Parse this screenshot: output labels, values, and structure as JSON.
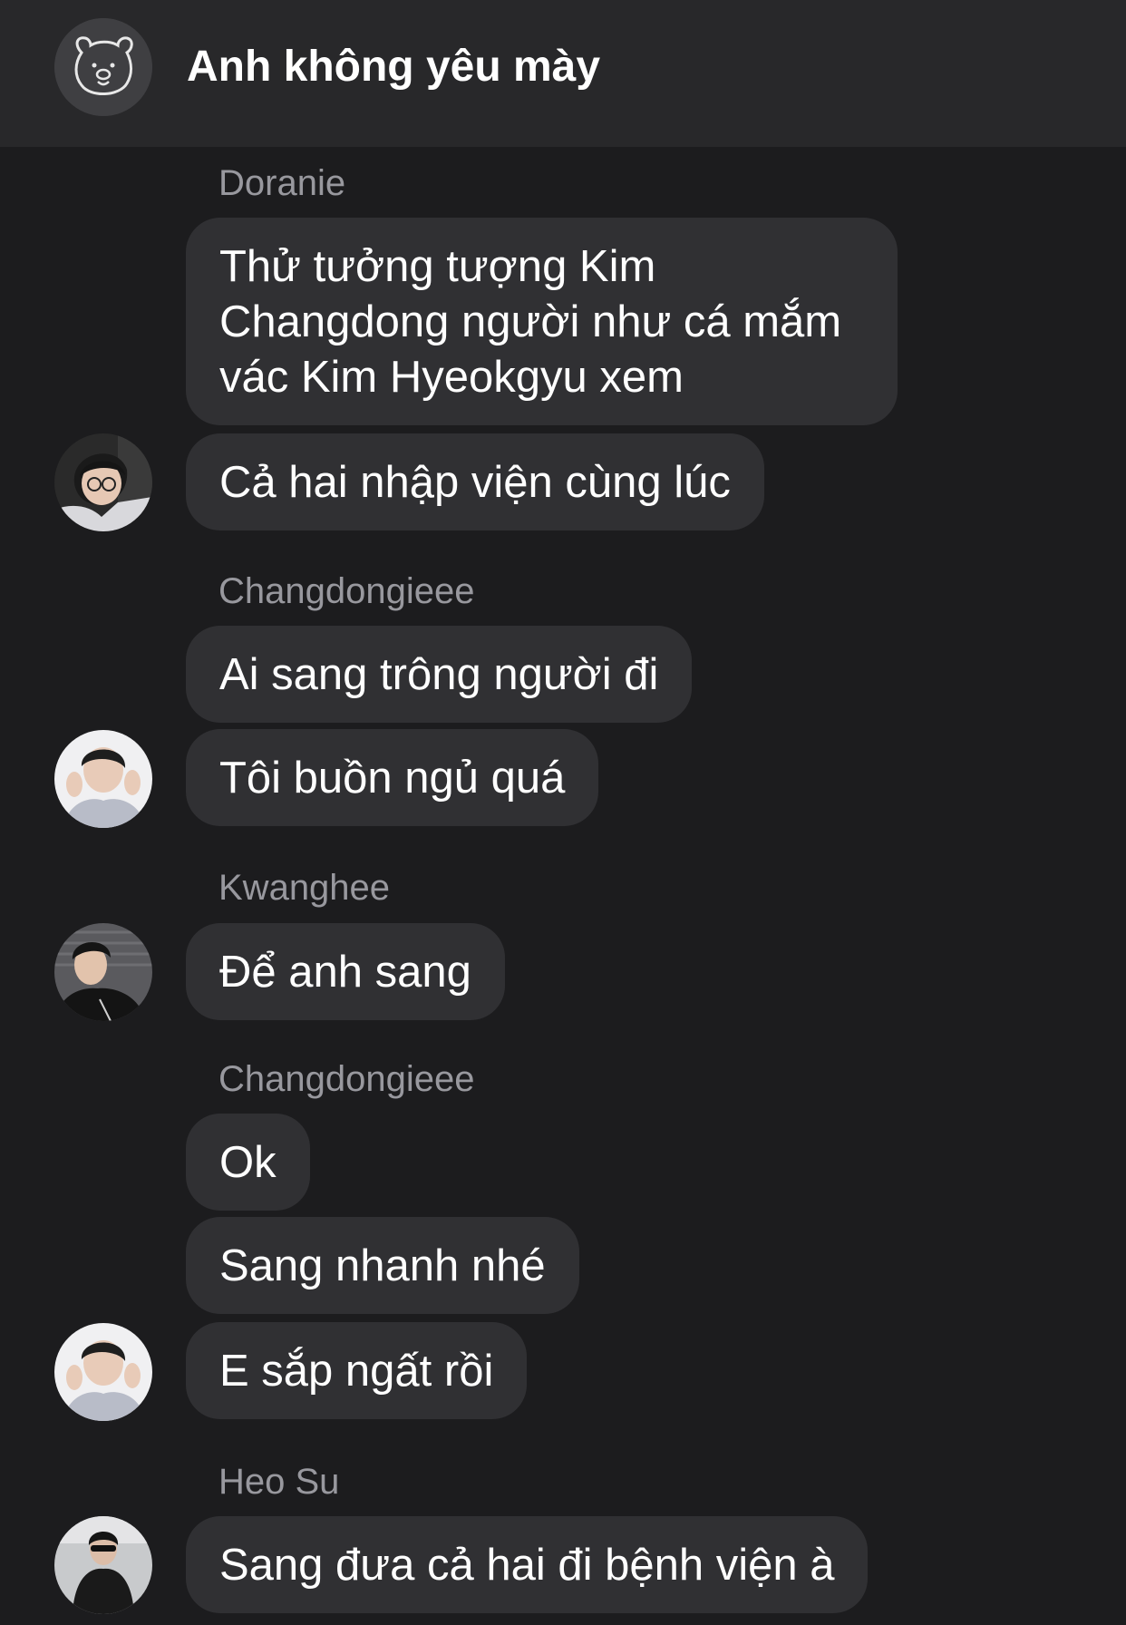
{
  "header": {
    "title": "Anh không yêu mày",
    "avatar_icon": "bear-face-icon"
  },
  "messages": [
    {
      "sender": "Doranie",
      "texts": [
        "Thử tưởng tượng Kim Changdong người như cá mắm vác Kim Hyeokgyu xem",
        "Cả hai nhập viện cùng lúc"
      ]
    },
    {
      "sender": "Changdongieee",
      "texts": [
        "Ai sang trông người đi",
        "Tôi buồn ngủ quá"
      ]
    },
    {
      "sender": "Kwanghee",
      "texts": [
        "Để anh sang"
      ]
    },
    {
      "sender": "Changdongieee",
      "texts": [
        "Ok",
        "Sang nhanh nhé",
        "E sắp ngất rồi"
      ]
    },
    {
      "sender": "Heo Su",
      "texts": [
        "Sang đưa cả hai đi bệnh viện à"
      ]
    }
  ],
  "colors": {
    "background": "#1c1c1e",
    "header": "#28282a",
    "bubble": "#303033",
    "sender_name": "#98989e"
  }
}
